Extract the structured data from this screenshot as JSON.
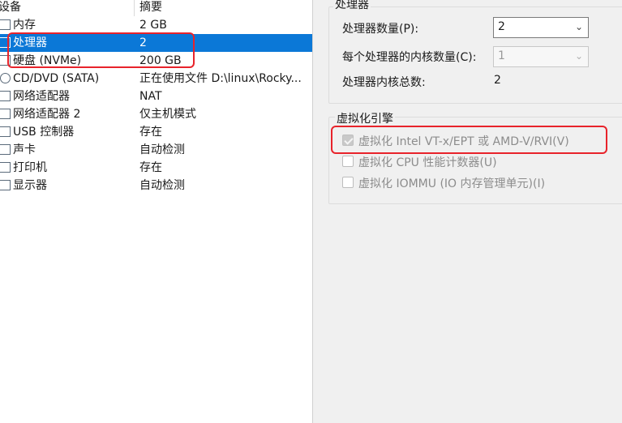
{
  "device_list": {
    "headers": {
      "device": "设备",
      "summary": "摘要"
    },
    "rows": [
      {
        "icon": "memory-icon",
        "name": "内存",
        "summary": "2 GB",
        "selected": false
      },
      {
        "icon": "processor-icon",
        "name": "处理器",
        "summary": "2",
        "selected": true
      },
      {
        "icon": "disk-icon",
        "name": "硬盘 (NVMe)",
        "summary": "200 GB",
        "selected": false
      },
      {
        "icon": "cd-dvd-icon",
        "name": "CD/DVD (SATA)",
        "summary": "正在使用文件 D:\\linux\\Rocky...",
        "selected": false
      },
      {
        "icon": "network-adapter-icon",
        "name": "网络适配器",
        "summary": "NAT",
        "selected": false
      },
      {
        "icon": "network-adapter-icon",
        "name": "网络适配器 2",
        "summary": "仅主机模式",
        "selected": false
      },
      {
        "icon": "usb-controller-icon",
        "name": "USB 控制器",
        "summary": "存在",
        "selected": false
      },
      {
        "icon": "sound-card-icon",
        "name": "声卡",
        "summary": "自动检测",
        "selected": false
      },
      {
        "icon": "printer-icon",
        "name": "打印机",
        "summary": "存在",
        "selected": false
      },
      {
        "icon": "display-icon",
        "name": "显示器",
        "summary": "自动检测",
        "selected": false
      }
    ]
  },
  "processor": {
    "group_title": "处理器",
    "count_label": "处理器数量(P):",
    "count_value": "2",
    "cores_label": "每个处理器的内核数量(C):",
    "cores_value": "1",
    "total_label": "处理器内核总数:",
    "total_value": "2"
  },
  "virtualization": {
    "group_title": "虚拟化引擎",
    "options": [
      {
        "label": "虚拟化 Intel VT-x/EPT 或 AMD-V/RVI(V)",
        "checked": true
      },
      {
        "label": "虚拟化 CPU 性能计数器(U)",
        "checked": false
      },
      {
        "label": "虚拟化 IOMMU (IO 内存管理单元)(I)",
        "checked": false
      }
    ]
  },
  "colors": {
    "selection": "#0b78d7",
    "highlight_box": "#e8232b"
  }
}
